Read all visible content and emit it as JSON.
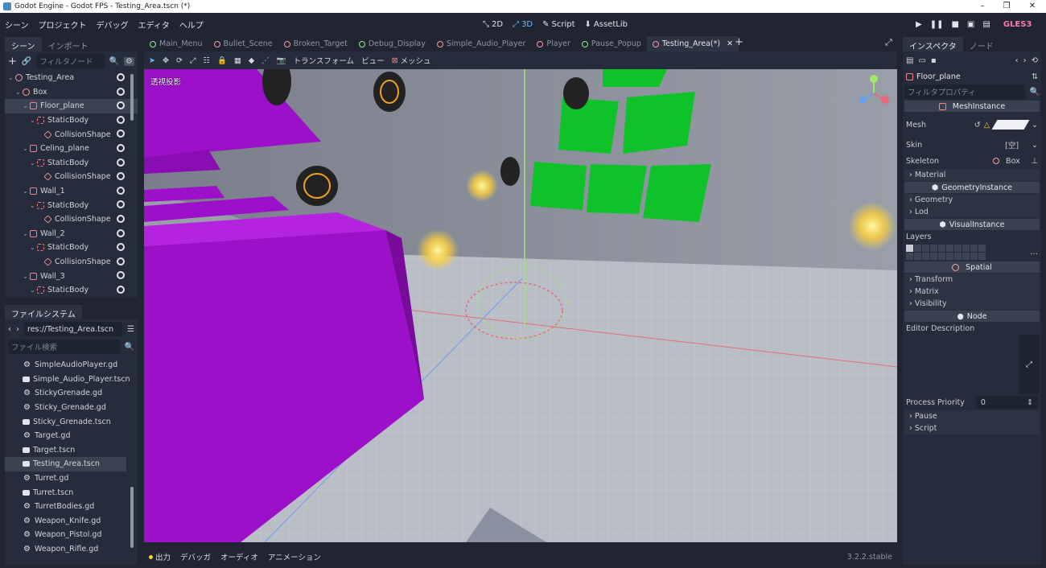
{
  "window": {
    "title": "Godot Engine - Godot FPS - Testing_Area.tscn (*)"
  },
  "menubar": {
    "items": [
      "シーン",
      "プロジェクト",
      "デバッグ",
      "エディタ",
      "ヘルプ"
    ]
  },
  "modes": [
    {
      "label": "2D",
      "icon": "2d-icon"
    },
    {
      "label": "3D",
      "icon": "3d-icon"
    },
    {
      "label": "Script",
      "icon": "script-icon"
    },
    {
      "label": "AssetLib",
      "icon": "assetlib-icon"
    }
  ],
  "renderer": "GLES3",
  "scene_dock": {
    "tabs": [
      "シーン",
      "インポート"
    ],
    "filter_placeholder": "フィルタノード",
    "tree": [
      {
        "label": "Testing_Area",
        "icon": "spatial",
        "depth": 0
      },
      {
        "label": "Box",
        "icon": "spatial",
        "depth": 1
      },
      {
        "label": "Floor_plane",
        "icon": "mesh",
        "depth": 2,
        "selected": true
      },
      {
        "label": "StaticBody",
        "icon": "body",
        "depth": 3
      },
      {
        "label": "CollisionShape",
        "icon": "coll",
        "depth": 4
      },
      {
        "label": "Celing_plane",
        "icon": "mesh",
        "depth": 2
      },
      {
        "label": "StaticBody",
        "icon": "body",
        "depth": 3
      },
      {
        "label": "CollisionShape",
        "icon": "coll",
        "depth": 4
      },
      {
        "label": "Wall_1",
        "icon": "mesh",
        "depth": 2
      },
      {
        "label": "StaticBody",
        "icon": "body",
        "depth": 3
      },
      {
        "label": "CollisionShape",
        "icon": "coll",
        "depth": 4
      },
      {
        "label": "Wall_2",
        "icon": "mesh",
        "depth": 2
      },
      {
        "label": "StaticBody",
        "icon": "body",
        "depth": 3
      },
      {
        "label": "CollisionShape",
        "icon": "coll",
        "depth": 4
      },
      {
        "label": "Wall_3",
        "icon": "mesh",
        "depth": 2
      },
      {
        "label": "StaticBody",
        "icon": "body",
        "depth": 3
      }
    ]
  },
  "filesystem": {
    "tab": "ファイルシステム",
    "path": "res://Testing_Area.tscn",
    "search_placeholder": "ファイル検索",
    "files": [
      {
        "label": "SimpleAudioPlayer.gd",
        "icon": "gear"
      },
      {
        "label": "Simple_Audio_Player.tscn",
        "icon": "scene"
      },
      {
        "label": "StickyGrenade.gd",
        "icon": "gear"
      },
      {
        "label": "Sticky_Grenade.gd",
        "icon": "gear"
      },
      {
        "label": "Sticky_Grenade.tscn",
        "icon": "scene"
      },
      {
        "label": "Target.gd",
        "icon": "gear"
      },
      {
        "label": "Target.tscn",
        "icon": "scene"
      },
      {
        "label": "Testing_Area.tscn",
        "icon": "scene",
        "selected": true
      },
      {
        "label": "Turret.gd",
        "icon": "gear"
      },
      {
        "label": "Turret.tscn",
        "icon": "scene"
      },
      {
        "label": "TurretBodies.gd",
        "icon": "gear"
      },
      {
        "label": "Weapon_Knife.gd",
        "icon": "gear"
      },
      {
        "label": "Weapon_Pistol.gd",
        "icon": "gear"
      },
      {
        "label": "Weapon_Rifle.gd",
        "icon": "gear"
      }
    ]
  },
  "editor_tabs": [
    {
      "label": "Main_Menu",
      "color": "#8eef97"
    },
    {
      "label": "Bullet_Scene",
      "color": "#fc9c9c"
    },
    {
      "label": "Broken_Target",
      "color": "#fc9c9c"
    },
    {
      "label": "Debug_Display",
      "color": "#8eef97"
    },
    {
      "label": "Simple_Audio_Player",
      "color": "#fc9c9c"
    },
    {
      "label": "Player",
      "color": "#fc9c9c"
    },
    {
      "label": "Pause_Popup",
      "color": "#8eef97"
    },
    {
      "label": "Testing_Area(*)",
      "color": "#fc9c9c",
      "active": true
    }
  ],
  "viewport_toolbar": {
    "transform": "トランスフォーム",
    "view": "ビュー",
    "mesh": "メッシュ"
  },
  "viewport": {
    "label": "透視投影"
  },
  "bottom": {
    "items": [
      "出力",
      "デバッガ",
      "オーディオ",
      "アニメーション"
    ],
    "version": "3.2.2.stable"
  },
  "inspector": {
    "tabs": [
      "インスペクタ",
      "ノード"
    ],
    "node_name": "Floor_plane",
    "filter_placeholder": "フィルタプロパティ",
    "sections": {
      "mesh_instance": "MeshInstance",
      "geometry_instance": "GeometryInstance",
      "visual_instance": "VisualInstance",
      "spatial": "Spatial",
      "node": "Node"
    },
    "props": {
      "mesh": "Mesh",
      "skin": "Skin",
      "skin_value": "[空]",
      "skeleton": "Skeleton",
      "skeleton_value": "Box",
      "material": "Material",
      "geometry": "Geometry",
      "lod": "Lod",
      "layers": "Layers",
      "transform": "Transform",
      "matrix": "Matrix",
      "visibility": "Visibility",
      "editor_description": "Editor Description",
      "process_priority": "Process Priority",
      "process_priority_value": "0",
      "pause": "Pause",
      "script": "Script"
    }
  }
}
